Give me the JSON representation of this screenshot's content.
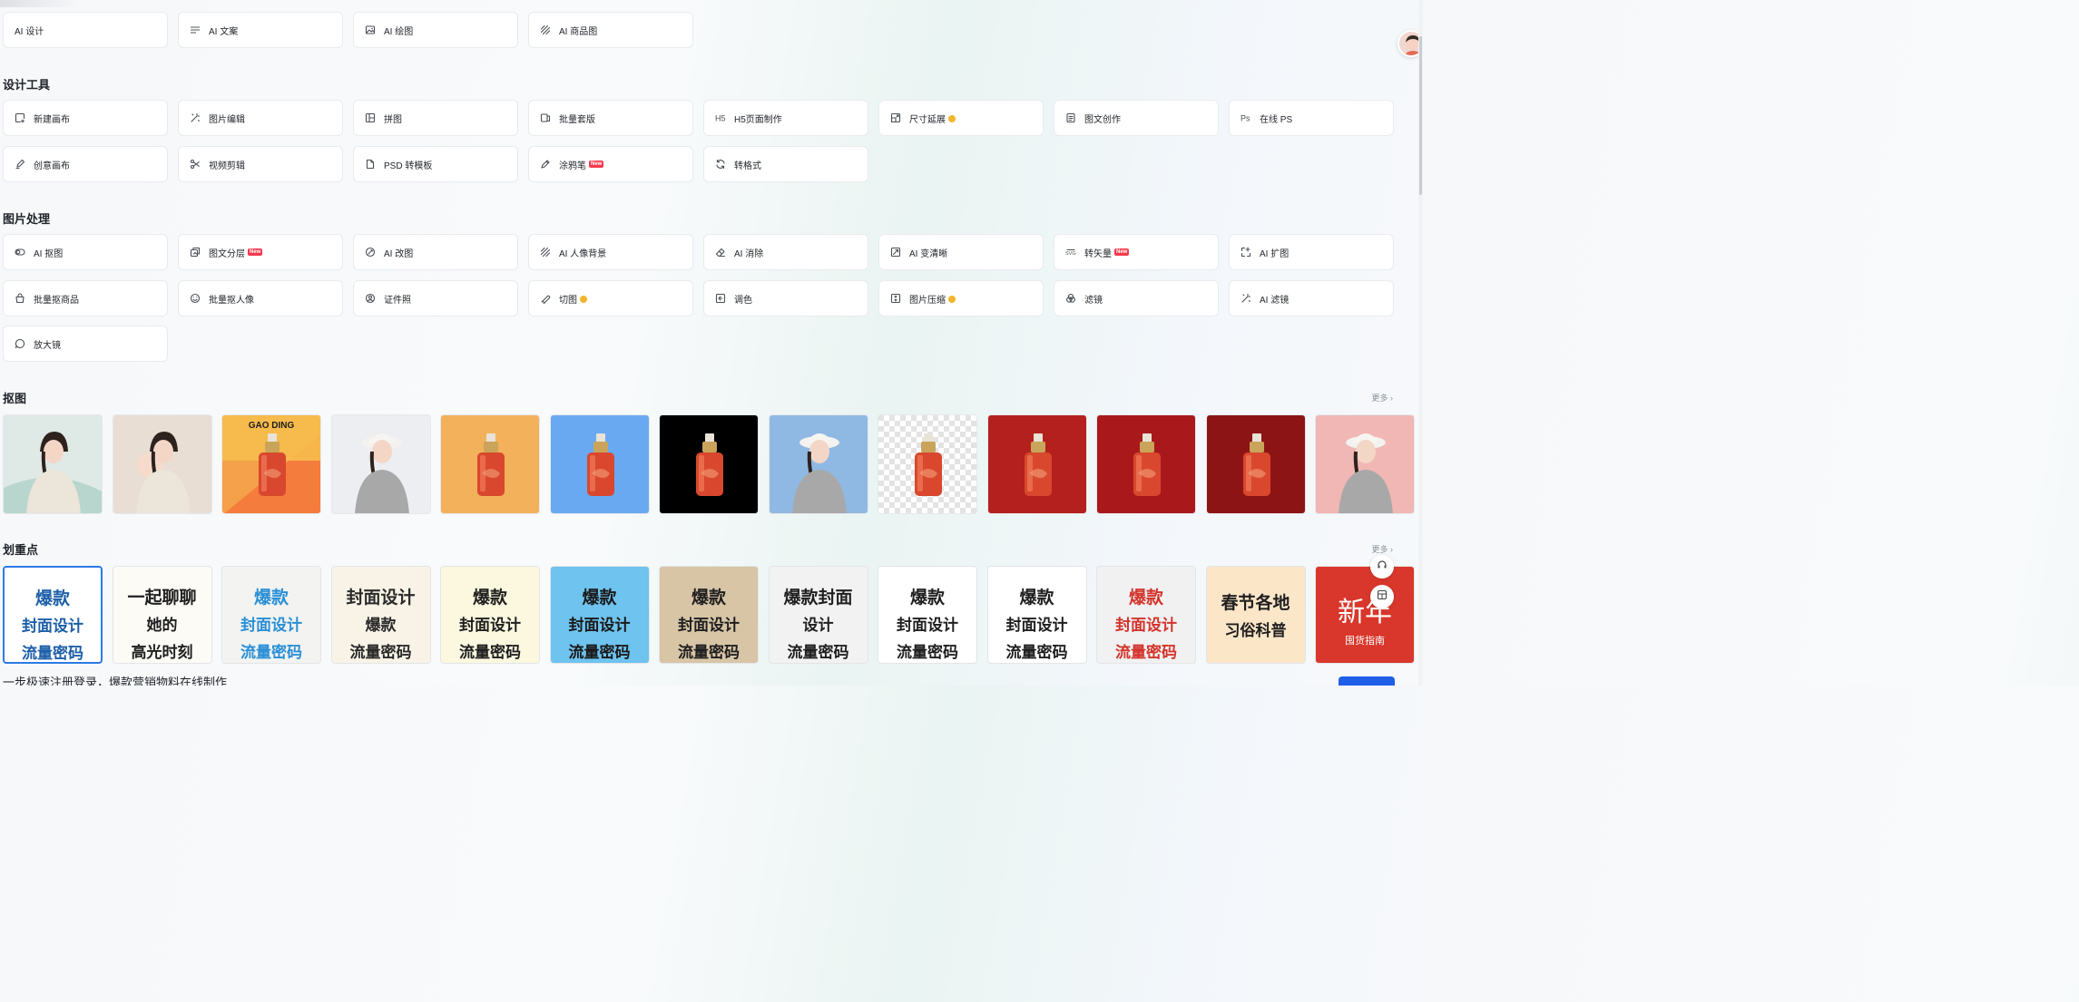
{
  "ai_row": [
    {
      "label": "AI 设计",
      "icon": "none"
    },
    {
      "label": "AI 文案",
      "icon": "text-lines-icon"
    },
    {
      "label": "AI 绘图",
      "icon": "image-draw-icon"
    },
    {
      "label": "AI 商品图",
      "icon": "diagonal-lines-icon"
    }
  ],
  "design_tools": {
    "title": "设计工具",
    "row1": [
      {
        "label": "新建画布",
        "icon": "new-canvas-icon"
      },
      {
        "label": "图片编辑",
        "icon": "magic-wand-icon"
      },
      {
        "label": "拼图",
        "icon": "grid-icon"
      },
      {
        "label": "批量套版",
        "icon": "batch-icon"
      },
      {
        "label": "H5页面制作",
        "icon": "h5-icon"
      },
      {
        "label": "尺寸延展",
        "icon": "resize-icon",
        "badge": "vip"
      },
      {
        "label": "图文创作",
        "icon": "document-icon"
      },
      {
        "label": "在线 PS",
        "icon": "ps-icon"
      }
    ],
    "row2": [
      {
        "label": "创意画布",
        "icon": "brush-icon"
      },
      {
        "label": "视频剪辑",
        "icon": "scissors-icon"
      },
      {
        "label": "PSD 转模板",
        "icon": "file-icon"
      },
      {
        "label": "涂鸦笔",
        "icon": "pen-icon",
        "badge": "New"
      },
      {
        "label": "转格式",
        "icon": "refresh-icon"
      }
    ]
  },
  "image_processing": {
    "title": "图片处理",
    "row1": [
      {
        "label": "AI 抠图",
        "icon": "toggle-icon"
      },
      {
        "label": "图文分层",
        "icon": "layers-icon",
        "badge": "New"
      },
      {
        "label": "AI 改图",
        "icon": "edit-image-icon"
      },
      {
        "label": "AI 人像背景",
        "icon": "diagonal-lines-icon"
      },
      {
        "label": "AI 消除",
        "icon": "eraser-icon"
      },
      {
        "label": "AI 变清晰",
        "icon": "enhance-icon"
      },
      {
        "label": "转矢量",
        "icon": "svg-icon",
        "badge": "New"
      },
      {
        "label": "AI 扩图",
        "icon": "expand-icon"
      }
    ],
    "row2": [
      {
        "label": "批量抠商品",
        "icon": "bag-icon"
      },
      {
        "label": "批量抠人像",
        "icon": "face-icon"
      },
      {
        "label": "证件照",
        "icon": "id-photo-icon"
      },
      {
        "label": "切图",
        "icon": "knife-icon",
        "badge": "vip"
      },
      {
        "label": "调色",
        "icon": "palette-icon"
      },
      {
        "label": "图片压缩",
        "icon": "compress-icon",
        "badge": "vip"
      },
      {
        "label": "滤镜",
        "icon": "filter-icon"
      },
      {
        "label": "AI 滤镜",
        "icon": "magic-wand-icon"
      }
    ],
    "row3": [
      {
        "label": "放大镜",
        "icon": "chat-icon"
      }
    ]
  },
  "cutout": {
    "title": "抠图",
    "more": "更多",
    "thumbs": [
      {
        "kind": "woman-poster",
        "bg": "#dfe9e6"
      },
      {
        "kind": "mother-baby",
        "bg": "#e8ded4"
      },
      {
        "kind": "bottle",
        "bg": "#f5a04a",
        "text": "GAO DING"
      },
      {
        "kind": "woman-hat",
        "bg": "#eceef1"
      },
      {
        "kind": "bottle",
        "bg": "#f3b15c"
      },
      {
        "kind": "bottle",
        "bg": "#69a9f2"
      },
      {
        "kind": "bottle",
        "bg": "#000000"
      },
      {
        "kind": "woman-hat",
        "bg": "#8fb8e3"
      },
      {
        "kind": "bottle",
        "bg": "checker"
      },
      {
        "kind": "bottle",
        "bg": "#b4201d"
      },
      {
        "kind": "bottle",
        "bg": "#a9191b"
      },
      {
        "kind": "bottle",
        "bg": "#8d1414"
      },
      {
        "kind": "woman-hat",
        "bg": "#f0b7b4"
      }
    ]
  },
  "highlight": {
    "title": "划重点",
    "more": "更多",
    "tiles": [
      {
        "l1": "爆款",
        "l2": "封面设计",
        "l3": "流量密码",
        "bg": "#ffffff"
      },
      {
        "l1": "一起聊聊",
        "l2": "她的",
        "l3": "高光时刻",
        "bg": "#fdfbf6"
      },
      {
        "l1": "爆款",
        "l2": "封面设计",
        "l3": "流量密码",
        "bg": "#f3f3f1"
      },
      {
        "l1": "封面设计",
        "l2": "爆款",
        "l3": "流量密码",
        "bg": "#f8f3e6"
      },
      {
        "l1": "爆款",
        "l2": "封面设计",
        "l3": "流量密码",
        "bg": "#fbf8df"
      },
      {
        "l1": "爆款",
        "l2": "封面设计",
        "l3": "流量密码",
        "bg": "#6ec3ef"
      },
      {
        "l1": "爆款",
        "l2": "封面设计",
        "l3": "流量密码",
        "bg": "#d7c5a6"
      },
      {
        "l1": "爆款封面",
        "l2": "设计",
        "l3": "流量密码",
        "bg": "#f2f2f2"
      },
      {
        "l1": "爆款",
        "l2": "封面设计",
        "l3": "流量密码",
        "bg": "#ffffff"
      },
      {
        "l1": "爆款",
        "l2": "封面设计",
        "l3": "流量密码",
        "bg": "#ffffff"
      },
      {
        "l1": "爆款",
        "l2": "封面设计",
        "l3": "流量密码",
        "bg": "#f1f1f1"
      },
      {
        "l1": "春节各地",
        "l2": "习俗科普",
        "l3": "",
        "bg": "#fbe6c8"
      },
      {
        "l1": "新年",
        "l2": "囤货指南",
        "l3": "",
        "bg": "#d9372b"
      }
    ]
  },
  "footer": {
    "text": "一步极速注册登录，爆款营销物料在线制作"
  },
  "colors": {
    "accent": "#1f5fe8",
    "new_badge": "#f5394d",
    "vip_badge": "#f3b52b"
  }
}
